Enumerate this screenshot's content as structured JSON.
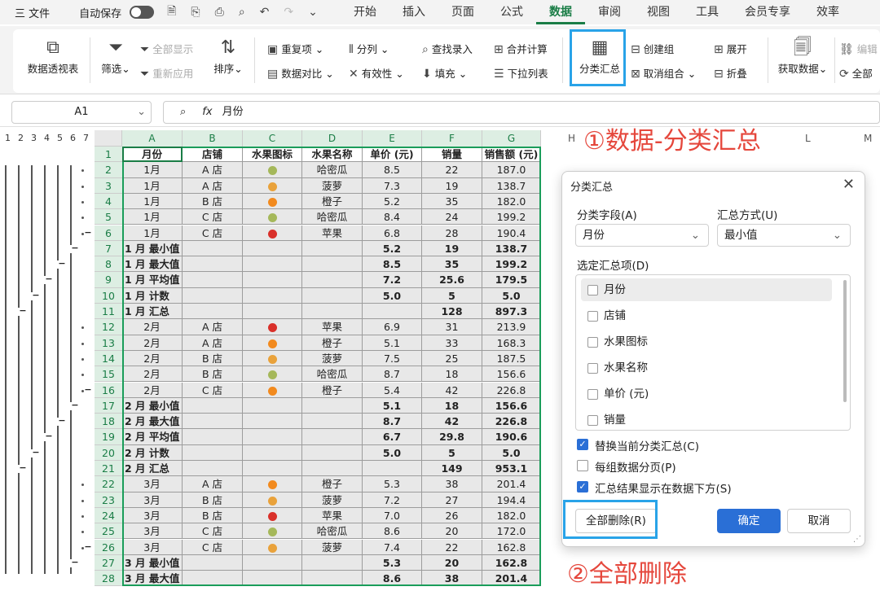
{
  "menubar": {
    "file": "三 文件",
    "autosave": "自动保存",
    "tabs": [
      "开始",
      "插入",
      "页面",
      "公式",
      "数据",
      "审阅",
      "视图",
      "工具",
      "会员专享",
      "效率"
    ],
    "active_tab": "数据"
  },
  "ribbon": {
    "pivot": "数据透视表",
    "filter": "筛选",
    "show_all": "全部显示",
    "reapply": "重新应用",
    "sort": "排序",
    "duplicates": "重复项",
    "compare": "数据对比",
    "split": "分列",
    "validity": "有效性",
    "lookup": "查找录入",
    "fill": "填充",
    "consolidate": "合并计算",
    "dropdown": "下拉列表",
    "subtotal": "分类汇总",
    "create_group": "创建组",
    "ungroup": "取消组合",
    "expand": "展开",
    "collapse": "折叠",
    "get_data": "获取数据",
    "edit": "编辑",
    "all": "全部"
  },
  "formula_bar": {
    "cell_ref": "A1",
    "fx": "fx",
    "value": "月份"
  },
  "outline_levels": [
    "1",
    "2",
    "3",
    "4",
    "5",
    "6",
    "7"
  ],
  "grid": {
    "columns": [
      "A",
      "B",
      "C",
      "D",
      "E",
      "F",
      "G"
    ],
    "right_columns": [
      "H",
      "L",
      "M"
    ],
    "fruit_colors": {
      "apple": "#d9302a",
      "orange": "#f28a1e",
      "melon": "#a5b85a",
      "pineapple": "#e9a23b"
    },
    "rows": [
      [
        "月份",
        "店铺",
        "水果图标",
        "水果名称",
        "单价 (元)",
        "销量",
        "销售额 (元)"
      ],
      [
        "1月",
        "A 店",
        "melon",
        "哈密瓜",
        "8.5",
        "22",
        "187.0"
      ],
      [
        "1月",
        "A 店",
        "pineapple",
        "菠萝",
        "7.3",
        "19",
        "138.7"
      ],
      [
        "1月",
        "B 店",
        "orange",
        "橙子",
        "5.2",
        "35",
        "182.0"
      ],
      [
        "1月",
        "C 店",
        "melon",
        "哈密瓜",
        "8.4",
        "24",
        "199.2"
      ],
      [
        "1月",
        "C 店",
        "apple",
        "苹果",
        "6.8",
        "28",
        "190.4"
      ],
      [
        "1 月 最小值",
        "",
        "",
        "",
        "5.2",
        "19",
        "138.7"
      ],
      [
        "1 月 最大值",
        "",
        "",
        "",
        "8.5",
        "35",
        "199.2"
      ],
      [
        "1 月 平均值",
        "",
        "",
        "",
        "7.2",
        "25.6",
        "179.5"
      ],
      [
        "1 月 计数",
        "",
        "",
        "",
        "5.0",
        "5",
        "5.0"
      ],
      [
        "1 月 汇总",
        "",
        "",
        "",
        "",
        "128",
        "897.3"
      ],
      [
        "2月",
        "A 店",
        "apple",
        "苹果",
        "6.9",
        "31",
        "213.9"
      ],
      [
        "2月",
        "A 店",
        "orange",
        "橙子",
        "5.1",
        "33",
        "168.3"
      ],
      [
        "2月",
        "B 店",
        "pineapple",
        "菠萝",
        "7.5",
        "25",
        "187.5"
      ],
      [
        "2月",
        "B 店",
        "melon",
        "哈密瓜",
        "8.7",
        "18",
        "156.6"
      ],
      [
        "2月",
        "C 店",
        "orange",
        "橙子",
        "5.4",
        "42",
        "226.8"
      ],
      [
        "2 月 最小值",
        "",
        "",
        "",
        "5.1",
        "18",
        "156.6"
      ],
      [
        "2 月 最大值",
        "",
        "",
        "",
        "8.7",
        "42",
        "226.8"
      ],
      [
        "2 月 平均值",
        "",
        "",
        "",
        "6.7",
        "29.8",
        "190.6"
      ],
      [
        "2 月 计数",
        "",
        "",
        "",
        "5.0",
        "5",
        "5.0"
      ],
      [
        "2 月 汇总",
        "",
        "",
        "",
        "",
        "149",
        "953.1"
      ],
      [
        "3月",
        "A 店",
        "orange",
        "橙子",
        "5.3",
        "38",
        "201.4"
      ],
      [
        "3月",
        "B 店",
        "pineapple",
        "菠萝",
        "7.2",
        "27",
        "194.4"
      ],
      [
        "3月",
        "B 店",
        "apple",
        "苹果",
        "7.0",
        "26",
        "182.0"
      ],
      [
        "3月",
        "C 店",
        "melon",
        "哈密瓜",
        "8.6",
        "20",
        "172.0"
      ],
      [
        "3月",
        "C 店",
        "pineapple",
        "菠萝",
        "7.4",
        "22",
        "162.8"
      ],
      [
        "3 月 最小值",
        "",
        "",
        "",
        "5.3",
        "20",
        "162.8"
      ],
      [
        "3 月 最大值",
        "",
        "",
        "",
        "8.6",
        "38",
        "201.4"
      ]
    ]
  },
  "annotations": {
    "step1": "①数据-分类汇总",
    "step2": "②全部删除"
  },
  "dialog": {
    "title": "分类汇总",
    "field_label": "分类字段(A)",
    "field_value": "月份",
    "method_label": "汇总方式(U)",
    "method_value": "最小值",
    "items_label": "选定汇总项(D)",
    "items": [
      "月份",
      "店铺",
      "水果图标",
      "水果名称",
      "单价 (元)",
      "销量"
    ],
    "options": [
      {
        "label": "替换当前分类汇总(C)",
        "checked": true
      },
      {
        "label": "每组数据分页(P)",
        "checked": false
      },
      {
        "label": "汇总结果显示在数据下方(S)",
        "checked": true
      }
    ],
    "remove_all": "全部删除(R)",
    "ok": "确定",
    "cancel": "取消"
  }
}
